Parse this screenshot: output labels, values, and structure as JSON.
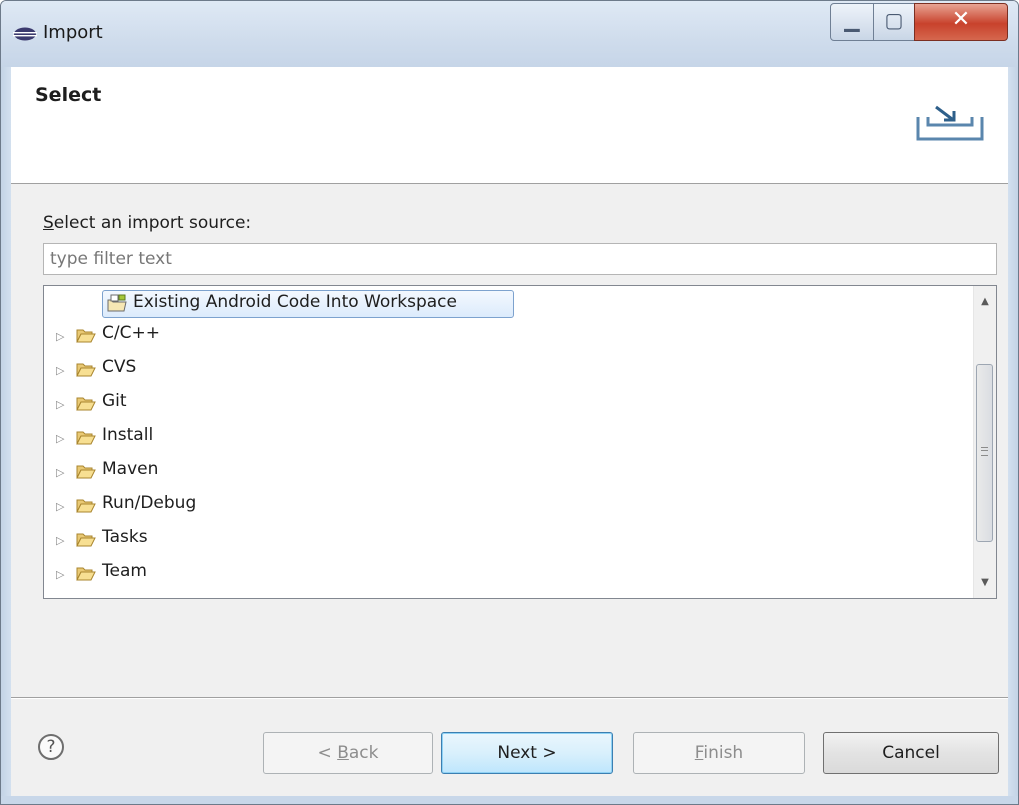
{
  "window": {
    "title": "Import"
  },
  "header": {
    "title": "Select"
  },
  "source": {
    "label_mnemonic": "S",
    "label_rest": "elect an import source:",
    "filter_placeholder": "type filter text",
    "filter_value": ""
  },
  "tree": {
    "selected": {
      "label": "Existing Android Code Into Workspace",
      "icon": "android-project-icon"
    },
    "items": [
      {
        "label": "C/C++",
        "icon": "folder-icon"
      },
      {
        "label": "CVS",
        "icon": "folder-icon"
      },
      {
        "label": "Git",
        "icon": "folder-icon"
      },
      {
        "label": "Install",
        "icon": "folder-icon"
      },
      {
        "label": "Maven",
        "icon": "folder-icon"
      },
      {
        "label": "Run/Debug",
        "icon": "folder-icon"
      },
      {
        "label": "Tasks",
        "icon": "folder-icon"
      },
      {
        "label": "Team",
        "icon": "folder-icon"
      }
    ]
  },
  "buttons": {
    "help": "?",
    "back_prefix": "< ",
    "back_mnemonic": "B",
    "back_rest": "ack",
    "next": "Next >",
    "finish_mnemonic": "F",
    "finish_rest": "inish",
    "cancel": "Cancel"
  },
  "colors": {
    "close_button": "#c8422c",
    "selection_border": "#7da2ce",
    "default_button_border": "#3c7fb1"
  }
}
